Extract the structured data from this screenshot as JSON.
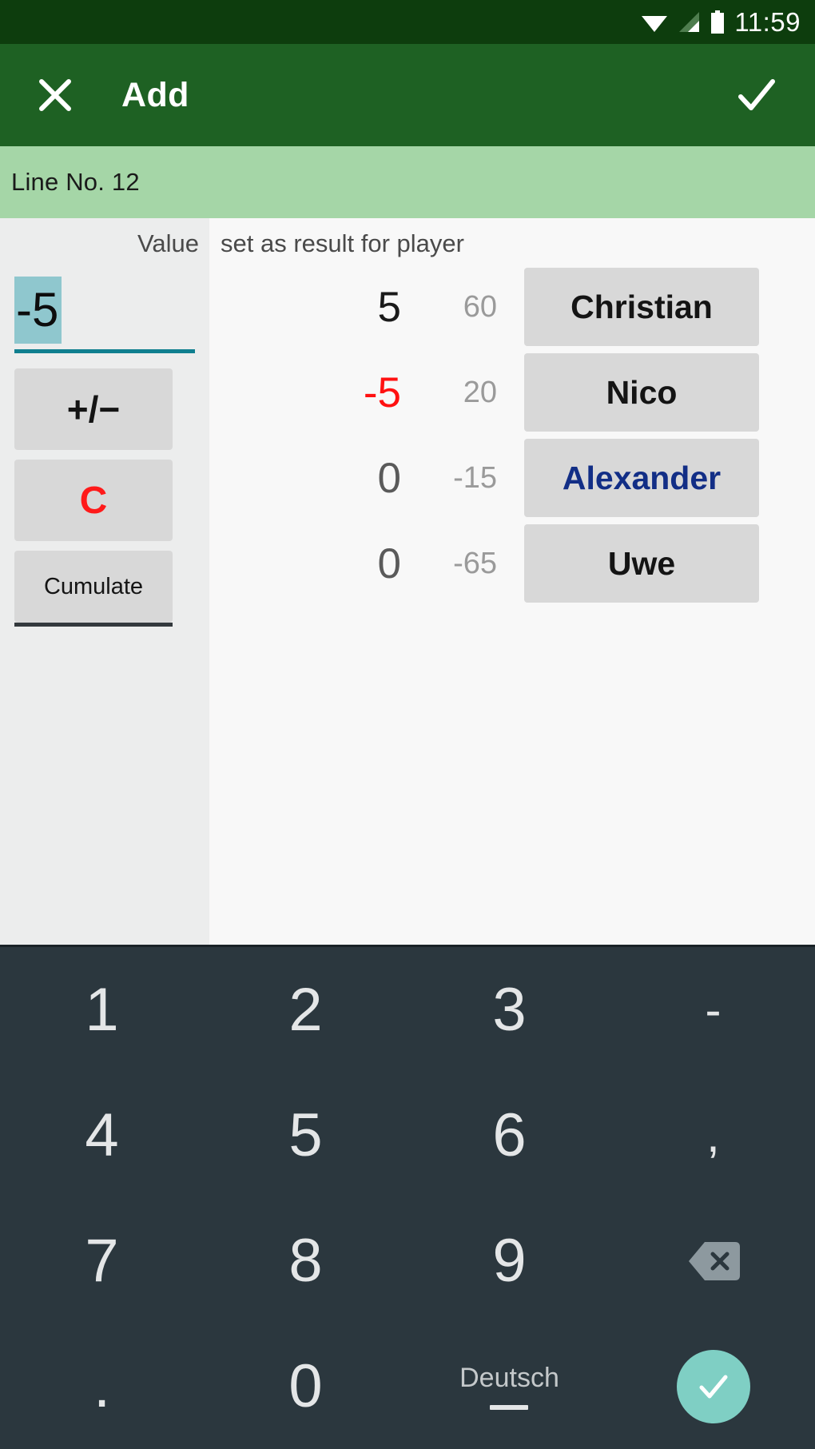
{
  "statusbar": {
    "time": "11:59",
    "icons": [
      "wifi-icon",
      "signal-icon",
      "battery-icon"
    ]
  },
  "appbar": {
    "close_label": "close-icon",
    "title": "Add",
    "done_label": "check-icon",
    "background": "#1e6123"
  },
  "banner": {
    "text": "Line No. 12",
    "background": "#a5d6a7"
  },
  "left_pane": {
    "value_label": "Value",
    "value_input": {
      "value": "-5",
      "selected": true,
      "selection_color": "#8fc7ce",
      "underline_color": "#0f7f8f"
    },
    "buttons": [
      {
        "label": "+/−",
        "name": "sign-toggle-button",
        "color": "#141414"
      },
      {
        "label": "C",
        "name": "clear-button",
        "color": "#ff1a1a"
      },
      {
        "label": "Cumulate",
        "name": "cumulate-button",
        "color": "#141414"
      }
    ]
  },
  "right_pane": {
    "header": "set as result for player",
    "players": [
      {
        "delta": "5",
        "delta_sign": "pos",
        "total": "60",
        "name": "Christian",
        "highlight": false
      },
      {
        "delta": "-5",
        "delta_sign": "neg",
        "total": "20",
        "name": "Nico",
        "highlight": false
      },
      {
        "delta": "0",
        "delta_sign": "zero",
        "total": "-15",
        "name": "Alexander",
        "highlight": true
      },
      {
        "delta": "0",
        "delta_sign": "zero",
        "total": "-65",
        "name": "Uwe",
        "highlight": false
      }
    ]
  },
  "keyboard": {
    "background": "#2b373e",
    "enter_color": "#7fcfc4",
    "language_label": "Deutsch",
    "rows": [
      [
        {
          "label": "1",
          "type": "digit",
          "name": "key-1"
        },
        {
          "label": "2",
          "type": "digit",
          "name": "key-2"
        },
        {
          "label": "3",
          "type": "digit",
          "name": "key-3"
        },
        {
          "label": "-",
          "type": "sym",
          "name": "key-minus"
        }
      ],
      [
        {
          "label": "4",
          "type": "digit",
          "name": "key-4"
        },
        {
          "label": "5",
          "type": "digit",
          "name": "key-5"
        },
        {
          "label": "6",
          "type": "digit",
          "name": "key-6"
        },
        {
          "label": ",",
          "type": "sym",
          "name": "key-comma"
        }
      ],
      [
        {
          "label": "7",
          "type": "digit",
          "name": "key-7"
        },
        {
          "label": "8",
          "type": "digit",
          "name": "key-8"
        },
        {
          "label": "9",
          "type": "digit",
          "name": "key-9"
        },
        {
          "label": "",
          "type": "backspace",
          "name": "key-backspace"
        }
      ],
      [
        {
          "label": ".",
          "type": "dot",
          "name": "key-period"
        },
        {
          "label": "0",
          "type": "digit",
          "name": "key-0"
        },
        {
          "label": "Deutsch",
          "type": "lang",
          "name": "key-language"
        },
        {
          "label": "",
          "type": "enter",
          "name": "key-enter"
        }
      ]
    ]
  }
}
